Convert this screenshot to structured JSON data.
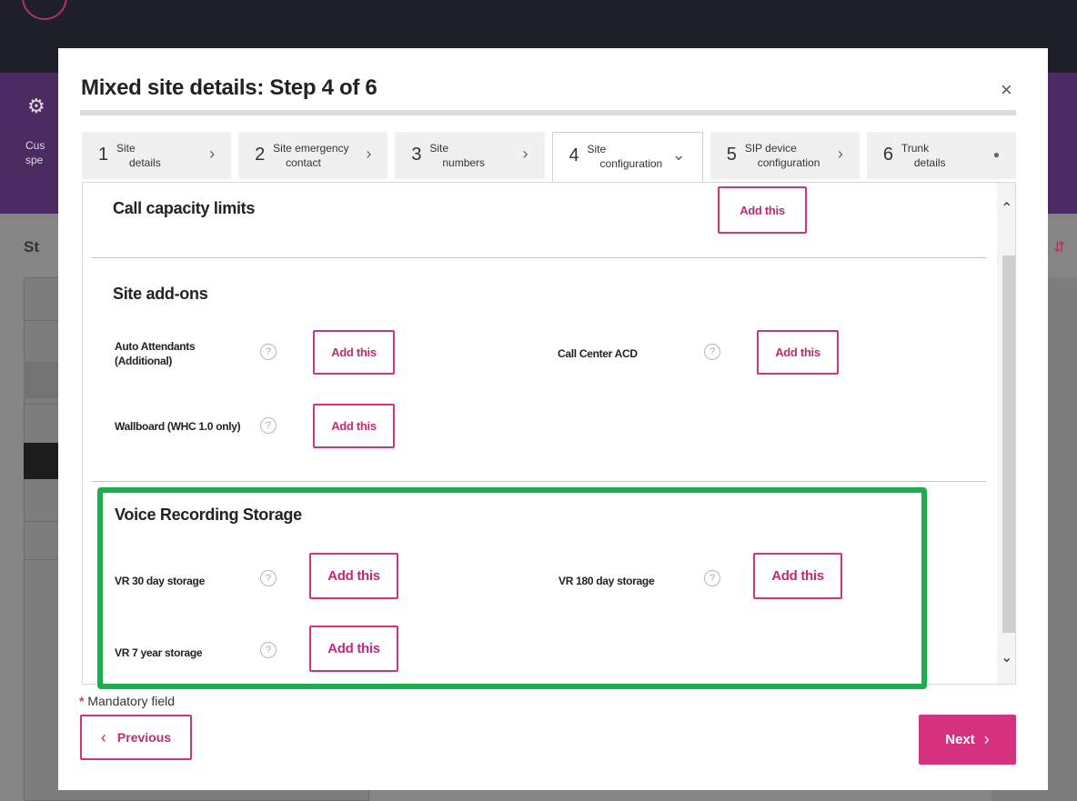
{
  "background": {
    "side_text_1": "Cus",
    "side_text_2": "spe",
    "section_text": "St"
  },
  "modal": {
    "title": "Mixed site details: Step 4 of 6",
    "close_label": "×"
  },
  "steps": [
    {
      "num": "1",
      "line1": "Site",
      "line2": "details",
      "indicator": "›"
    },
    {
      "num": "2",
      "line1": "Site emergency",
      "line2": "contact",
      "indicator": "›"
    },
    {
      "num": "3",
      "line1": "Site",
      "line2": "numbers",
      "indicator": "›"
    },
    {
      "num": "4",
      "line1": "Site",
      "line2": "configuration",
      "indicator": "⌄"
    },
    {
      "num": "5",
      "line1": "SIP device",
      "line2": "configuration",
      "indicator": "›"
    },
    {
      "num": "6",
      "line1": "Trunk",
      "line2": "details",
      "indicator": "●"
    }
  ],
  "active_step": 4,
  "sections": {
    "call_capacity": {
      "title": "Call capacity limits",
      "button": "Add this"
    },
    "site_addons": {
      "title": "Site add-ons",
      "items": [
        {
          "label": "Auto Attendants (Additional)",
          "button": "Add this"
        },
        {
          "label": "Call Center ACD",
          "button": "Add this"
        },
        {
          "label": "Wallboard (WHC 1.0 only)",
          "button": "Add this"
        }
      ]
    },
    "voice_recording": {
      "title": "Voice Recording Storage",
      "items": [
        {
          "label": "VR 30 day storage",
          "button": "Add this"
        },
        {
          "label": "VR 180 day storage",
          "button": "Add this"
        },
        {
          "label": "VR 7 year storage",
          "button": "Add this"
        }
      ]
    }
  },
  "help_glyph": "?",
  "footer": {
    "mandatory_star": "*",
    "mandatory_text": "Mandatory field",
    "previous_label": "Previous",
    "previous_chevron": "‹",
    "next_label": "Next",
    "next_chevron": "›"
  },
  "colors": {
    "accent": "#d6317e",
    "highlight": "#1cae4e"
  }
}
